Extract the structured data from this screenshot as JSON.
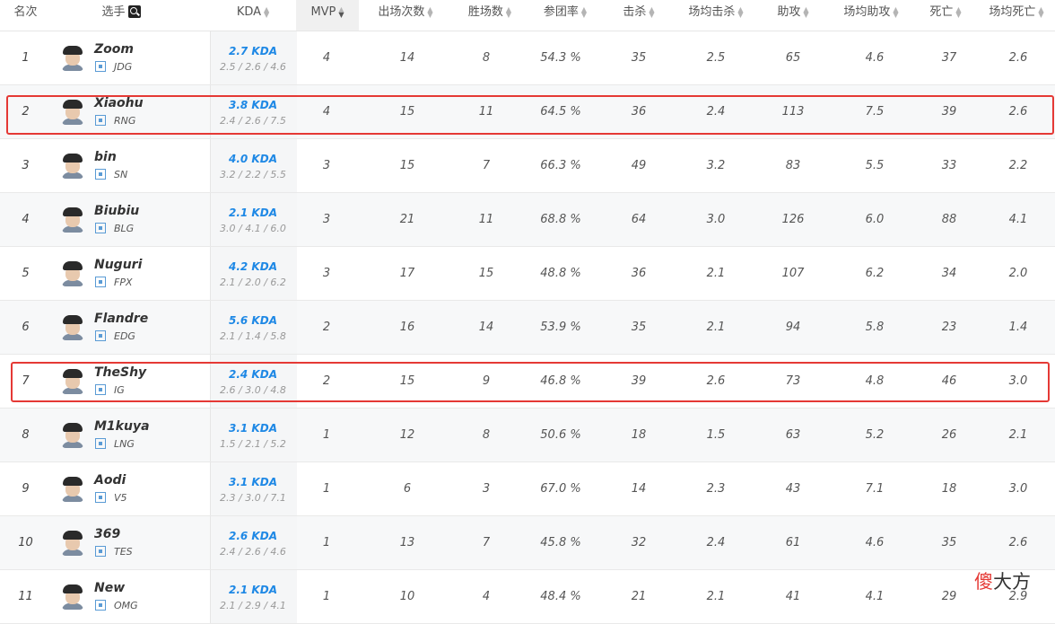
{
  "columns": [
    {
      "key": "rank",
      "label": "名次",
      "sortable": false
    },
    {
      "key": "player",
      "label": "选手",
      "sortable": false
    },
    {
      "key": "kda",
      "label": "KDA",
      "sortable": true
    },
    {
      "key": "mvp",
      "label": "MVP",
      "sortable": true
    },
    {
      "key": "games",
      "label": "出场次数",
      "sortable": true
    },
    {
      "key": "wins",
      "label": "胜场数",
      "sortable": true
    },
    {
      "key": "kp",
      "label": "参团率",
      "sortable": true
    },
    {
      "key": "kills",
      "label": "击杀",
      "sortable": true
    },
    {
      "key": "avg_kills",
      "label": "场均击杀",
      "sortable": true
    },
    {
      "key": "assists",
      "label": "助攻",
      "sortable": true
    },
    {
      "key": "avg_assists",
      "label": "场均助攻",
      "sortable": true
    },
    {
      "key": "deaths",
      "label": "死亡",
      "sortable": true
    },
    {
      "key": "avg_deaths",
      "label": "场均死亡",
      "sortable": true
    }
  ],
  "sorted_column": "mvp",
  "icons": {
    "search": "search-icon",
    "sort": "sort-arrows-icon",
    "team": "team-logo-icon",
    "avatar": "player-avatar"
  },
  "rows": [
    {
      "rank": "1",
      "name": "Zoom",
      "team": "JDG",
      "kda": "2.7 KDA",
      "kda_sub": "2.5 / 2.6 / 4.6",
      "mvp": "4",
      "games": "14",
      "wins": "8",
      "kp": "54.3 %",
      "kills": "35",
      "avg_kills": "2.5",
      "assists": "65",
      "avg_assists": "4.6",
      "deaths": "37",
      "avg_deaths": "2.6"
    },
    {
      "rank": "2",
      "name": "Xiaohu",
      "team": "RNG",
      "kda": "3.8 KDA",
      "kda_sub": "2.4 / 2.6 / 7.5",
      "mvp": "4",
      "games": "15",
      "wins": "11",
      "kp": "64.5 %",
      "kills": "36",
      "avg_kills": "2.4",
      "assists": "113",
      "avg_assists": "7.5",
      "deaths": "39",
      "avg_deaths": "2.6"
    },
    {
      "rank": "3",
      "name": "bin",
      "team": "SN",
      "kda": "4.0 KDA",
      "kda_sub": "3.2 / 2.2 / 5.5",
      "mvp": "3",
      "games": "15",
      "wins": "7",
      "kp": "66.3 %",
      "kills": "49",
      "avg_kills": "3.2",
      "assists": "83",
      "avg_assists": "5.5",
      "deaths": "33",
      "avg_deaths": "2.2"
    },
    {
      "rank": "4",
      "name": "Biubiu",
      "team": "BLG",
      "kda": "2.1 KDA",
      "kda_sub": "3.0 / 4.1 / 6.0",
      "mvp": "3",
      "games": "21",
      "wins": "11",
      "kp": "68.8 %",
      "kills": "64",
      "avg_kills": "3.0",
      "assists": "126",
      "avg_assists": "6.0",
      "deaths": "88",
      "avg_deaths": "4.1"
    },
    {
      "rank": "5",
      "name": "Nuguri",
      "team": "FPX",
      "kda": "4.2 KDA",
      "kda_sub": "2.1 / 2.0 / 6.2",
      "mvp": "3",
      "games": "17",
      "wins": "15",
      "kp": "48.8 %",
      "kills": "36",
      "avg_kills": "2.1",
      "assists": "107",
      "avg_assists": "6.2",
      "deaths": "34",
      "avg_deaths": "2.0"
    },
    {
      "rank": "6",
      "name": "Flandre",
      "team": "EDG",
      "kda": "5.6 KDA",
      "kda_sub": "2.1 / 1.4 / 5.8",
      "mvp": "2",
      "games": "16",
      "wins": "14",
      "kp": "53.9 %",
      "kills": "35",
      "avg_kills": "2.1",
      "assists": "94",
      "avg_assists": "5.8",
      "deaths": "23",
      "avg_deaths": "1.4"
    },
    {
      "rank": "7",
      "name": "TheShy",
      "team": "IG",
      "kda": "2.4 KDA",
      "kda_sub": "2.6 / 3.0 / 4.8",
      "mvp": "2",
      "games": "15",
      "wins": "9",
      "kp": "46.8 %",
      "kills": "39",
      "avg_kills": "2.6",
      "assists": "73",
      "avg_assists": "4.8",
      "deaths": "46",
      "avg_deaths": "3.0"
    },
    {
      "rank": "8",
      "name": "M1kuya",
      "team": "LNG",
      "kda": "3.1 KDA",
      "kda_sub": "1.5 / 2.1 / 5.2",
      "mvp": "1",
      "games": "12",
      "wins": "8",
      "kp": "50.6 %",
      "kills": "18",
      "avg_kills": "1.5",
      "assists": "63",
      "avg_assists": "5.2",
      "deaths": "26",
      "avg_deaths": "2.1"
    },
    {
      "rank": "9",
      "name": "Aodi",
      "team": "V5",
      "kda": "3.1 KDA",
      "kda_sub": "2.3 / 3.0 / 7.1",
      "mvp": "1",
      "games": "6",
      "wins": "3",
      "kp": "67.0 %",
      "kills": "14",
      "avg_kills": "2.3",
      "assists": "43",
      "avg_assists": "7.1",
      "deaths": "18",
      "avg_deaths": "3.0"
    },
    {
      "rank": "10",
      "name": "369",
      "team": "TES",
      "kda": "2.6 KDA",
      "kda_sub": "2.4 / 2.6 / 4.6",
      "mvp": "1",
      "games": "13",
      "wins": "7",
      "kp": "45.8 %",
      "kills": "32",
      "avg_kills": "2.4",
      "assists": "61",
      "avg_assists": "4.6",
      "deaths": "35",
      "avg_deaths": "2.6"
    },
    {
      "rank": "11",
      "name": "New",
      "team": "OMG",
      "kda": "2.1 KDA",
      "kda_sub": "2.1 / 2.9 / 4.1",
      "mvp": "1",
      "games": "10",
      "wins": "4",
      "kp": "48.4 %",
      "kills": "21",
      "avg_kills": "2.1",
      "assists": "41",
      "avg_assists": "4.1",
      "deaths": "29",
      "avg_deaths": "2.9"
    }
  ],
  "highlighted_ranks": [
    "2",
    "7"
  ],
  "highlight_color": "#e53935",
  "kda_color": "#1e88e5",
  "watermark": {
    "first": "傻",
    "rest": "大方"
  }
}
